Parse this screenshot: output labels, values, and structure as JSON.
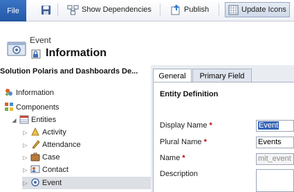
{
  "ribbon": {
    "file_label": "File",
    "save_icon": "save-icon",
    "show_dependencies_label": "Show Dependencies",
    "publish_label": "Publish",
    "update_icons_label": "Update Icons"
  },
  "header": {
    "subtitle": "Event",
    "title": "Information"
  },
  "nav": {
    "heading": "Solution Polaris and Dashboards De...",
    "items": [
      {
        "label": "Information",
        "icon": "information-icon",
        "level": 0
      },
      {
        "label": "Components",
        "icon": "components-icon",
        "level": 0
      },
      {
        "label": "Entities",
        "icon": "entities-icon",
        "level": 1,
        "expanded": true
      },
      {
        "label": "Activity",
        "icon": "activity-icon",
        "level": 2
      },
      {
        "label": "Attendance",
        "icon": "attendance-icon",
        "level": 2
      },
      {
        "label": "Case",
        "icon": "case-icon",
        "level": 2
      },
      {
        "label": "Contact",
        "icon": "contact-icon",
        "level": 2
      },
      {
        "label": "Event",
        "icon": "event-icon",
        "level": 2,
        "selected": true
      }
    ]
  },
  "tabs": {
    "general": "General",
    "primary_field": "Primary Field"
  },
  "form": {
    "section_title": "Entity Definition",
    "display_name_label": "Display Name",
    "display_name_value": "Event",
    "plural_name_label": "Plural Name",
    "plural_name_value": "Events",
    "name_label": "Name",
    "name_value": "mit_event",
    "description_label": "Description",
    "required_marker": "*"
  },
  "colors": {
    "file_tab": "#2a62b3",
    "required": "#c00000",
    "selection": "#3563b8"
  }
}
